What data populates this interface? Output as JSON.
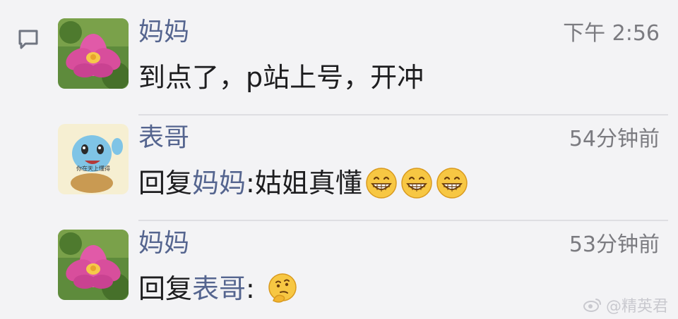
{
  "comments": [
    {
      "author": "妈妈",
      "time": "下午 2:56",
      "text": "到点了，p站上号，开冲",
      "avatar": "lotus-flower"
    },
    {
      "author": "表哥",
      "time": "54分钟前",
      "reply_prefix": "回复",
      "reply_to": "妈妈",
      "separator": ":",
      "text": " 姑姐真懂",
      "emojis": [
        "grin-icon",
        "grin-icon",
        "grin-icon"
      ],
      "avatar": "squirtle-sticker",
      "avatar_caption": "你在天上懂得"
    },
    {
      "author": "妈妈",
      "time": "53分钟前",
      "reply_prefix": "回复",
      "reply_to": "表哥",
      "separator": ":",
      "emojis": [
        "thinking-icon"
      ],
      "avatar": "lotus-flower"
    }
  ],
  "watermark": "@精英君",
  "colors": {
    "name": "#55658f",
    "text": "#1d1d1f",
    "time": "#7b7b80",
    "background": "#f3f3f5"
  }
}
